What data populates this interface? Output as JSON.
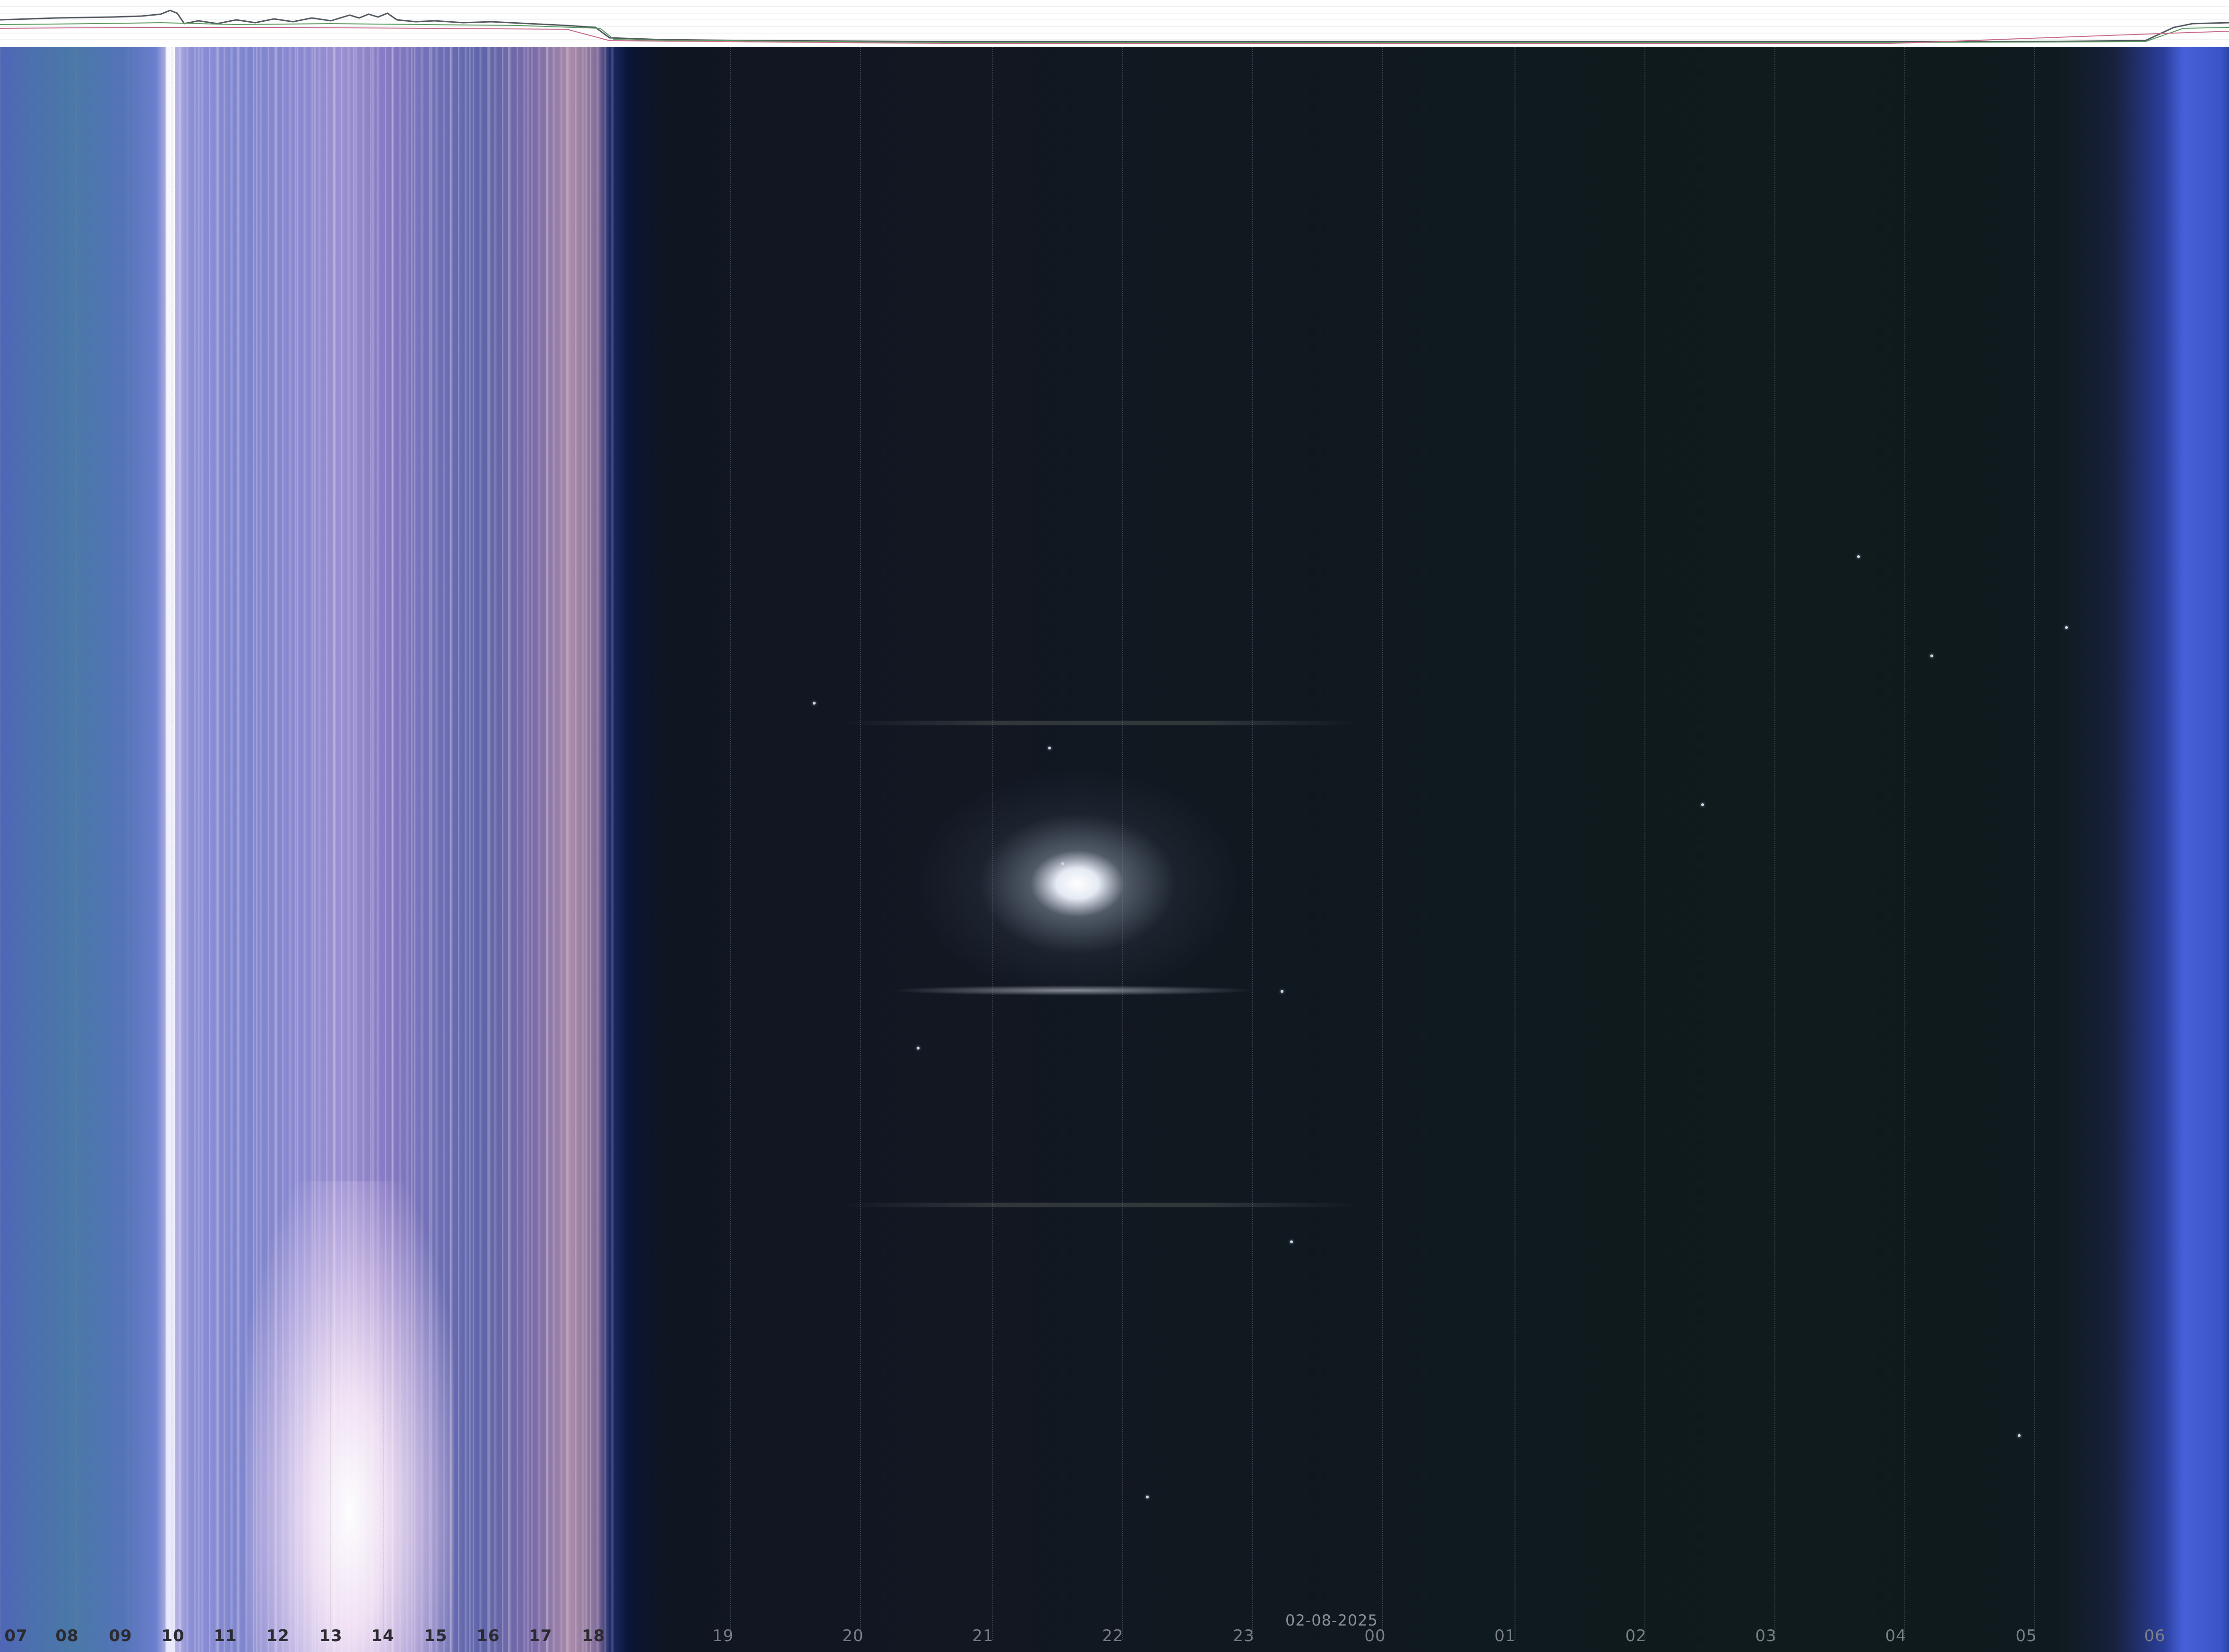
{
  "date_label": "02-08-2025",
  "hour_labels": [
    "07",
    "08",
    "09",
    "10",
    "11",
    "12",
    "13",
    "14",
    "15",
    "16",
    "17",
    "18",
    "19",
    "20",
    "21",
    "22",
    "23",
    "00",
    "01",
    "02",
    "03",
    "04",
    "05",
    "06"
  ],
  "colors": {
    "day_sky": "#6c7fcc",
    "night_sky": "#101820",
    "dawn_edge": "#4760d8",
    "trace_background": "#ffffff"
  }
}
